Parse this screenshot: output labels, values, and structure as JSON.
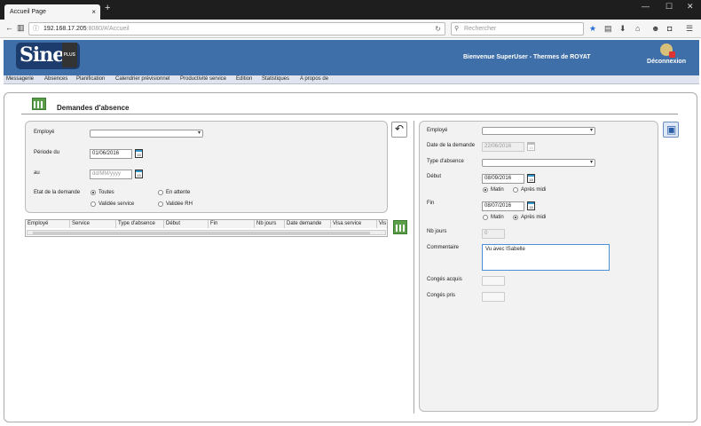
{
  "browser": {
    "tab_title": "Accueil Page",
    "tab_close": "×",
    "new_tab": "+",
    "url_host": "192.168.17.205",
    "url_rest": ":8080/#/Accueil",
    "search_placeholder": "Rechercher"
  },
  "header": {
    "logo_text": "Sinex",
    "logo_sub": "PLUS",
    "welcome": "Bienvenue SuperUser - Thermes de ROYAT",
    "logout": "Déconnexion"
  },
  "menu": [
    "Messagerie",
    "Absences",
    "Planification",
    "Calendrier prévisionnel",
    "Productivité service",
    "Edition",
    "Statistiques",
    "A propos de"
  ],
  "page": {
    "title": "Demandes d'absence"
  },
  "filter": {
    "employe_label": "Employé",
    "periode_label": "Période du",
    "periode_from": "01/06/2016",
    "au_label": "au",
    "au_placeholder": "dd/MM/yyyy",
    "etat_label": "Etat de la demande",
    "opt_toutes": "Toutes",
    "opt_en_attente": "En attente",
    "opt_validee_service": "Validée service",
    "opt_validee_rh": "Validée RH"
  },
  "grid": {
    "columns": [
      "Employé",
      "Service",
      "Type d'absence",
      "Début",
      "Fin",
      "Nb jours",
      "Date demande",
      "Visa service",
      "Vis"
    ]
  },
  "form": {
    "employe_label": "Employé",
    "date_demande_label": "Date de la demande",
    "date_demande_value": "22/06/2016",
    "type_label": "Type d'absence",
    "debut_label": "Début",
    "debut_value": "08/09/2016",
    "debut_opt_matin": "Matin",
    "debut_opt_aprem": "Après midi",
    "fin_label": "Fin",
    "fin_value": "08/07/2016",
    "fin_opt_matin": "Matin",
    "fin_opt_aprem": "Après midi",
    "nb_jours_label": "Nb jours",
    "nb_jours_value": "0",
    "commentaire_label": "Commentaire",
    "commentaire_value": "Vu avec ISabelle",
    "conges_acquis_label": "Congés acquis",
    "conges_pris_label": "Congés pris"
  },
  "calendar_icon_text": "15"
}
